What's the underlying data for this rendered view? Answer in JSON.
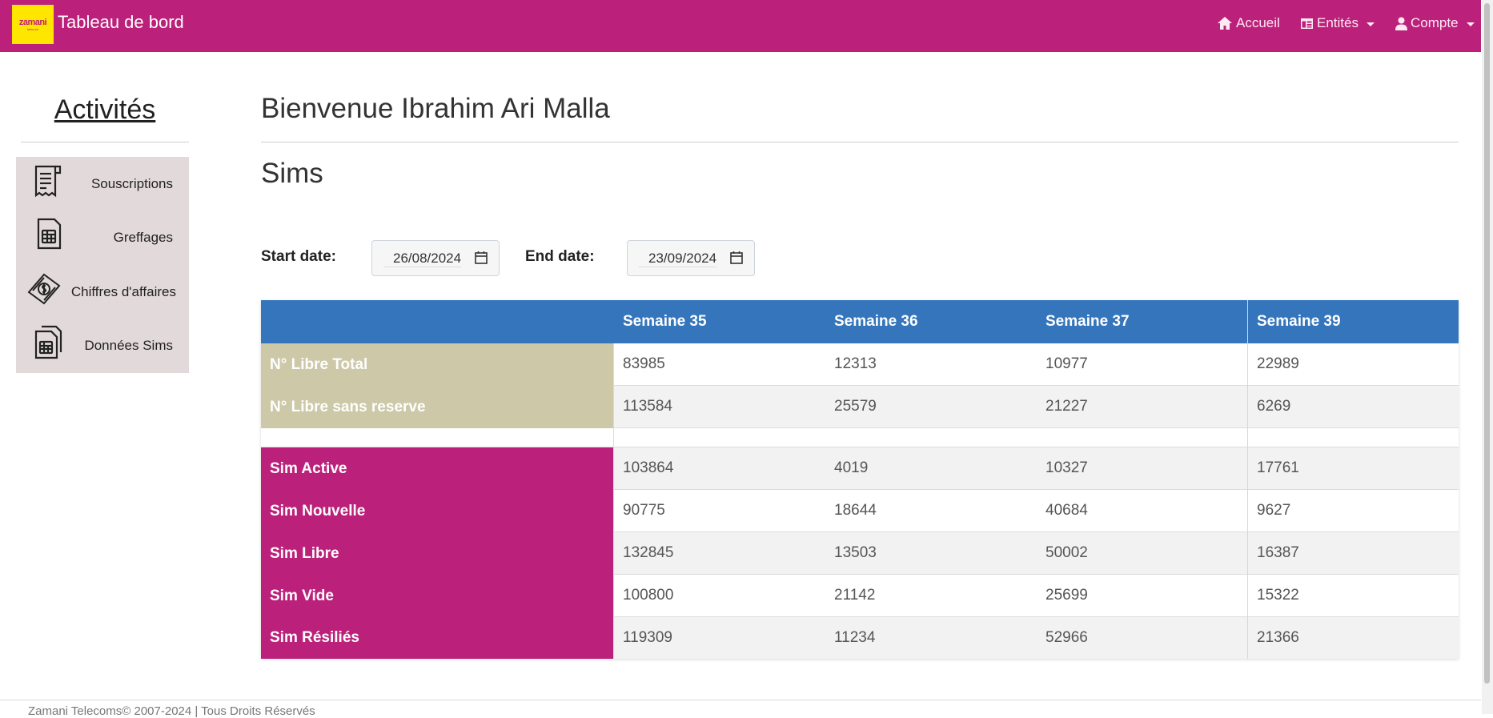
{
  "navbar": {
    "logo_text": "zamani",
    "logo_sub": "telecom",
    "title": "Tableau de bord",
    "items": [
      {
        "label": "Accueil",
        "icon": "home-icon"
      },
      {
        "label": "Entités",
        "icon": "table-icon"
      },
      {
        "label": "Compte",
        "icon": "user-icon"
      }
    ],
    "color": "#bb217a"
  },
  "sidebar": {
    "title": "Activités",
    "items": [
      {
        "label": "Souscriptions",
        "icon": "receipt-icon"
      },
      {
        "label": "Greffages",
        "icon": "sim-card-icon"
      },
      {
        "label": "Chiffres d'affaires",
        "icon": "money-icon"
      },
      {
        "label": "Données Sims",
        "icon": "sim-cards-icon"
      }
    ]
  },
  "main": {
    "welcome": "Bienvenue Ibrahim Ari Malla",
    "section_title": "Sims",
    "start_label": "Start date:",
    "start_value": "26/08/2024",
    "end_label": "End date:",
    "end_value": "23/09/2024"
  },
  "table": {
    "columns": [
      "",
      "Semaine 35",
      "Semaine 36",
      "Semaine 37",
      "Semaine 39"
    ],
    "rows": [
      {
        "label": "N° Libre Total",
        "values": [
          "83985",
          "12313",
          "10977",
          "22989"
        ]
      },
      {
        "label": "N° Libre sans reserve",
        "values": [
          "113584",
          "25579",
          "21227",
          "6269"
        ]
      },
      {
        "label": "Sim Active",
        "values": [
          "103864",
          "4019",
          "10327",
          "17761"
        ]
      },
      {
        "label": "Sim Nouvelle",
        "values": [
          "90775",
          "18644",
          "40684",
          "9627"
        ]
      },
      {
        "label": "Sim Libre",
        "values": [
          "132845",
          "13503",
          "50002",
          "16387"
        ]
      },
      {
        "label": "Sim Vide",
        "values": [
          "100800",
          "21142",
          "25699",
          "15322"
        ]
      },
      {
        "label": "Sim Résiliés",
        "values": [
          "119309",
          "11234",
          "52966",
          "21366"
        ]
      }
    ],
    "colors": {
      "header": "#3475bb",
      "group1": "#cdc8a7",
      "group2": "#bb217a"
    }
  },
  "footer": {
    "text": "Zamani Telecoms© 2007-2024 | Tous Droits Réservés"
  }
}
